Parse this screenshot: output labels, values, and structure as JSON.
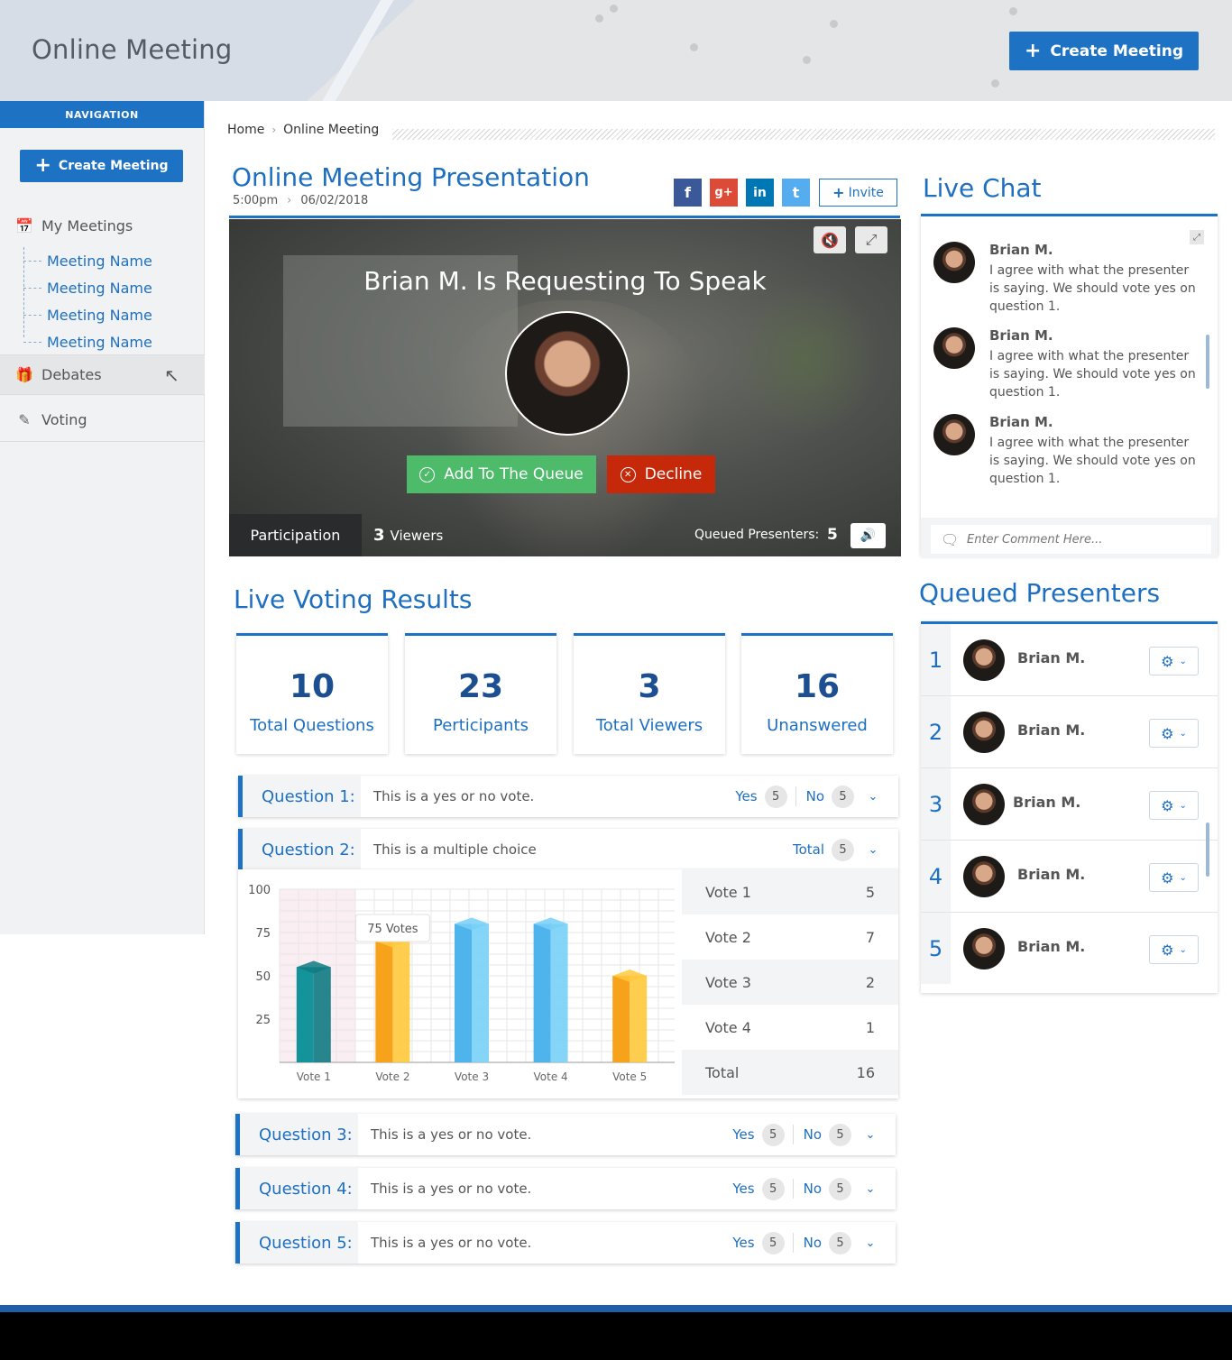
{
  "header": {
    "title": "Online Meeting",
    "create_label": "Create Meeting"
  },
  "sidebar": {
    "nav_label": "NAVIGATION",
    "create_label": "Create Meeting",
    "my_meetings": "My Meetings",
    "meetings": [
      "Meeting Name",
      "Meeting Name",
      "Meeting Name",
      "Meeting Name"
    ],
    "debates": "Debates",
    "voting": "Voting"
  },
  "breadcrumb": [
    "Home",
    "Online Meeting"
  ],
  "presentation": {
    "title": "Online Meeting Presentation",
    "time": "5:00pm",
    "date": "06/02/2018",
    "invite_label": "Invite",
    "social": [
      "f",
      "g+",
      "in",
      "t"
    ]
  },
  "video": {
    "request_text": "Brian M. Is Requesting To Speak",
    "add_queue_label": "Add To The Queue",
    "decline_label": "Decline",
    "participation_label": "Participation",
    "viewers_count": "3",
    "viewers_label": "Viewers",
    "queued_label": "Queued Presenters:",
    "queued_count": "5"
  },
  "voting": {
    "title": "Live Voting Results",
    "stats": [
      {
        "value": "10",
        "label": "Total Questions"
      },
      {
        "value": "23",
        "label": "Perticipants"
      },
      {
        "value": "3",
        "label": "Total Viewers"
      },
      {
        "value": "16",
        "label": "Unanswered"
      }
    ],
    "questions": [
      {
        "name": "Question 1:",
        "desc": "This is a yes or no vote.",
        "yes": "Yes",
        "yes_count": "5",
        "no": "No",
        "no_count": "5"
      },
      {
        "name": "Question 2:",
        "desc": "This is a multiple choice",
        "total": "Total",
        "total_count": "5"
      },
      {
        "name": "Question 3:",
        "desc": "This is a yes or no vote.",
        "yes": "Yes",
        "yes_count": "5",
        "no": "No",
        "no_count": "5"
      },
      {
        "name": "Question 4:",
        "desc": "This is a yes or no vote.",
        "yes": "Yes",
        "yes_count": "5",
        "no": "No",
        "no_count": "5"
      },
      {
        "name": "Question 5:",
        "desc": "This is a yes or no vote.",
        "yes": "Yes",
        "yes_count": "5",
        "no": "No",
        "no_count": "5"
      }
    ],
    "vote_table": [
      {
        "label": "Vote 1",
        "value": "5"
      },
      {
        "label": "Vote 2",
        "value": "7"
      },
      {
        "label": "Vote 3",
        "value": "2"
      },
      {
        "label": "Vote 4",
        "value": "1"
      },
      {
        "label": "Total",
        "value": "16"
      }
    ]
  },
  "chart_data": {
    "type": "bar",
    "categories": [
      "Vote 1",
      "Vote 2",
      "Vote 3",
      "Vote 4",
      "Vote 5"
    ],
    "values": [
      55,
      70,
      80,
      80,
      50
    ],
    "colors": [
      "#14939b",
      "#f7a21b",
      "#4fb3ec",
      "#4fb3ec",
      "#f7a21b"
    ],
    "yticks": [
      25,
      50,
      75,
      100
    ],
    "ylim": [
      0,
      100
    ],
    "tooltip": "75 Votes",
    "grid": true
  },
  "chat": {
    "title": "Live Chat",
    "messages": [
      {
        "name": "Brian M.",
        "text": "I agree with what the presenter is saying. We should vote yes on question 1."
      },
      {
        "name": "Brian M.",
        "text": "I agree with what the presenter is saying. We should vote yes on question 1."
      },
      {
        "name": "Brian M.",
        "text": "I agree with what the presenter is saying. We should vote yes on question 1."
      }
    ],
    "placeholder": "Enter Comment Here..."
  },
  "queued": {
    "title": "Queued Presenters",
    "presenters": [
      {
        "index": "1",
        "name": "Brian M."
      },
      {
        "index": "2",
        "name": "Brian M."
      },
      {
        "index": "3",
        "name": "Brian M."
      },
      {
        "index": "4",
        "name": "Brian M."
      },
      {
        "index": "5",
        "name": "Brian M."
      }
    ]
  }
}
